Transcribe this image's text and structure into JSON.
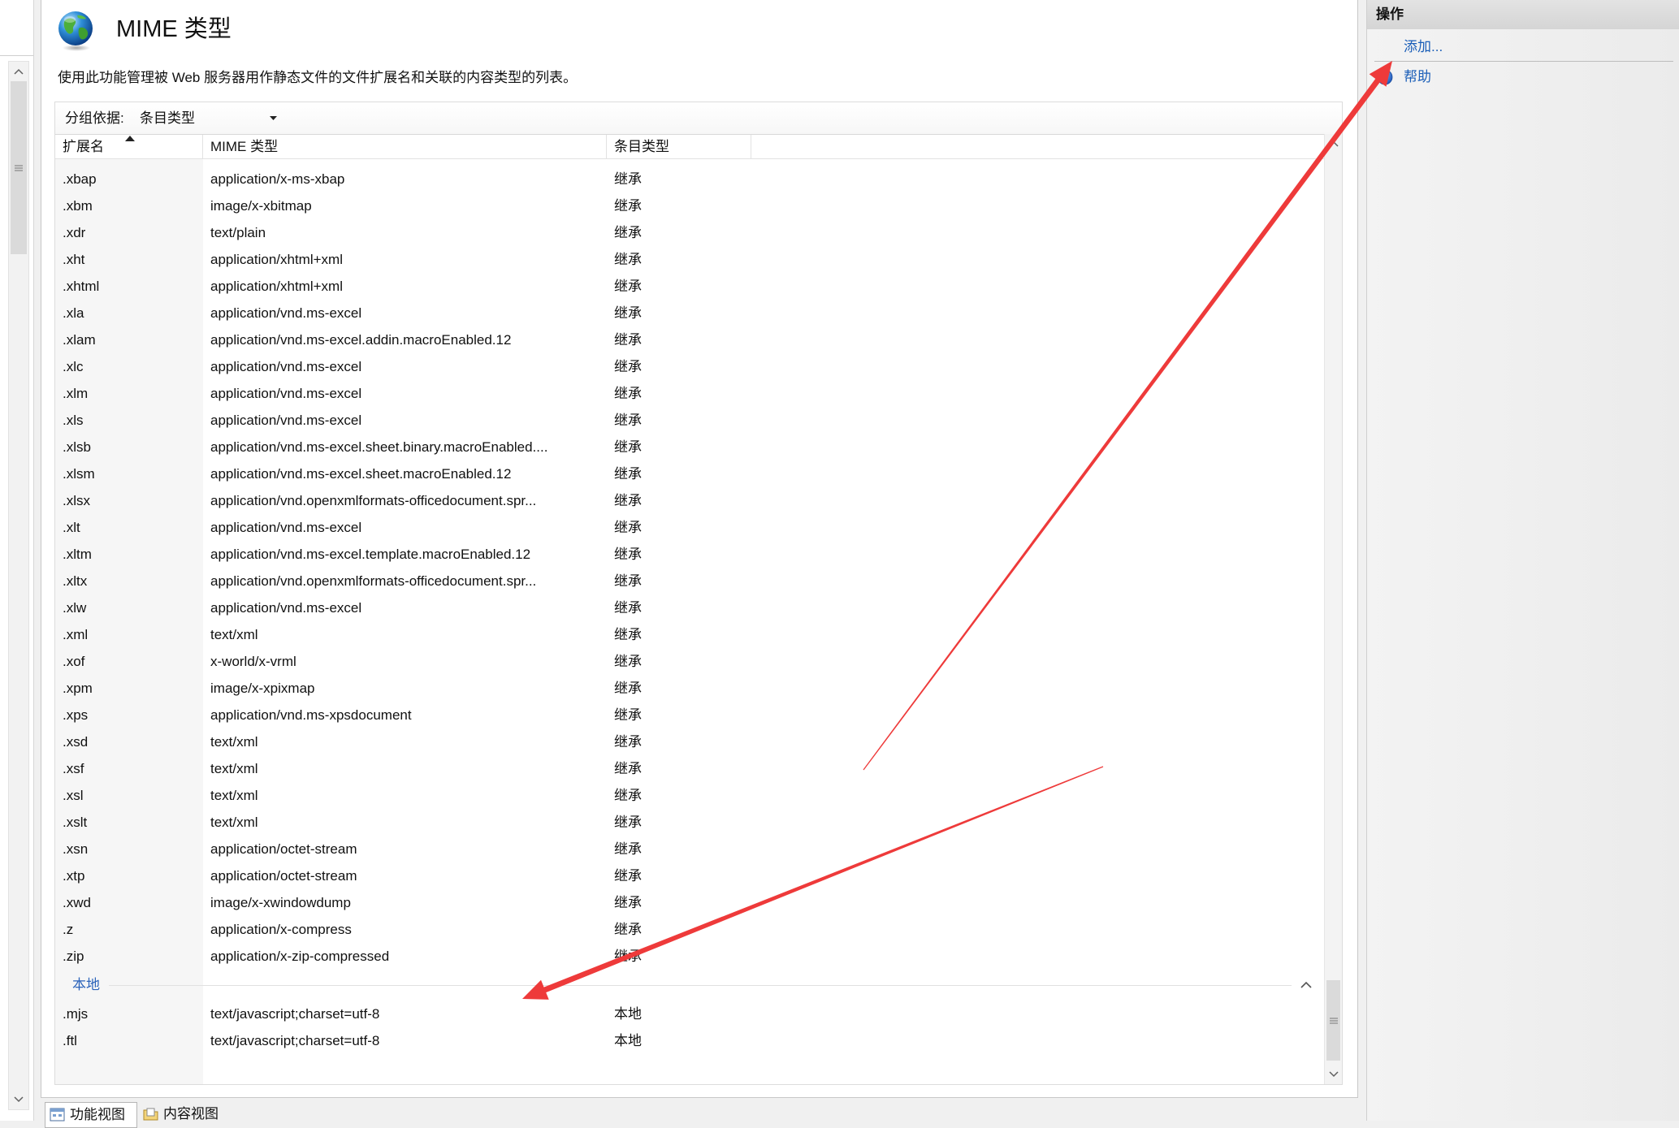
{
  "feature": {
    "icon": "globe-icon",
    "title": "MIME 类型",
    "description": "使用此功能管理被 Web 服务器用作静态文件的文件扩展名和关联的内容类型的列表。"
  },
  "group_by": {
    "label": "分组依据:",
    "value": "条目类型",
    "dropdown_icon": "dropdown-arrow-icon"
  },
  "table": {
    "columns": [
      {
        "label": "扩展名",
        "sort_icon": "sort-ascending-icon"
      },
      {
        "label": "MIME 类型"
      },
      {
        "label": "条目类型"
      }
    ],
    "rows": [
      {
        "ext": ".xbap",
        "mime": "application/x-ms-xbap",
        "type": "继承"
      },
      {
        "ext": ".xbm",
        "mime": "image/x-xbitmap",
        "type": "继承"
      },
      {
        "ext": ".xdr",
        "mime": "text/plain",
        "type": "继承"
      },
      {
        "ext": ".xht",
        "mime": "application/xhtml+xml",
        "type": "继承"
      },
      {
        "ext": ".xhtml",
        "mime": "application/xhtml+xml",
        "type": "继承"
      },
      {
        "ext": ".xla",
        "mime": "application/vnd.ms-excel",
        "type": "继承"
      },
      {
        "ext": ".xlam",
        "mime": "application/vnd.ms-excel.addin.macroEnabled.12",
        "type": "继承"
      },
      {
        "ext": ".xlc",
        "mime": "application/vnd.ms-excel",
        "type": "继承"
      },
      {
        "ext": ".xlm",
        "mime": "application/vnd.ms-excel",
        "type": "继承"
      },
      {
        "ext": ".xls",
        "mime": "application/vnd.ms-excel",
        "type": "继承"
      },
      {
        "ext": ".xlsb",
        "mime": "application/vnd.ms-excel.sheet.binary.macroEnabled....",
        "type": "继承"
      },
      {
        "ext": ".xlsm",
        "mime": "application/vnd.ms-excel.sheet.macroEnabled.12",
        "type": "继承"
      },
      {
        "ext": ".xlsx",
        "mime": "application/vnd.openxmlformats-officedocument.spr...",
        "type": "继承"
      },
      {
        "ext": ".xlt",
        "mime": "application/vnd.ms-excel",
        "type": "继承"
      },
      {
        "ext": ".xltm",
        "mime": "application/vnd.ms-excel.template.macroEnabled.12",
        "type": "继承"
      },
      {
        "ext": ".xltx",
        "mime": "application/vnd.openxmlformats-officedocument.spr...",
        "type": "继承"
      },
      {
        "ext": ".xlw",
        "mime": "application/vnd.ms-excel",
        "type": "继承"
      },
      {
        "ext": ".xml",
        "mime": "text/xml",
        "type": "继承"
      },
      {
        "ext": ".xof",
        "mime": "x-world/x-vrml",
        "type": "继承"
      },
      {
        "ext": ".xpm",
        "mime": "image/x-xpixmap",
        "type": "继承"
      },
      {
        "ext": ".xps",
        "mime": "application/vnd.ms-xpsdocument",
        "type": "继承"
      },
      {
        "ext": ".xsd",
        "mime": "text/xml",
        "type": "继承"
      },
      {
        "ext": ".xsf",
        "mime": "text/xml",
        "type": "继承"
      },
      {
        "ext": ".xsl",
        "mime": "text/xml",
        "type": "继承"
      },
      {
        "ext": ".xslt",
        "mime": "text/xml",
        "type": "继承"
      },
      {
        "ext": ".xsn",
        "mime": "application/octet-stream",
        "type": "继承"
      },
      {
        "ext": ".xtp",
        "mime": "application/octet-stream",
        "type": "继承"
      },
      {
        "ext": ".xwd",
        "mime": "image/x-xwindowdump",
        "type": "继承"
      },
      {
        "ext": ".z",
        "mime": "application/x-compress",
        "type": "继承"
      },
      {
        "ext": ".zip",
        "mime": "application/x-zip-compressed",
        "type": "继承"
      }
    ],
    "local_group": {
      "name": "本地",
      "collapse_icon": "chevron-up-icon",
      "rows": [
        {
          "ext": ".mjs",
          "mime": "text/javascript;charset=utf-8",
          "type": "本地"
        },
        {
          "ext": ".ftl",
          "mime": "text/javascript;charset=utf-8",
          "type": "本地"
        }
      ]
    }
  },
  "view_tabs": [
    {
      "label": "功能视图",
      "icon": "features-view-icon",
      "active": true
    },
    {
      "label": "内容视图",
      "icon": "content-view-icon",
      "active": false
    }
  ],
  "actions": {
    "title": "操作",
    "items": [
      {
        "label": "添加..."
      },
      {
        "label": "帮助",
        "icon": "help-icon"
      }
    ]
  },
  "colors": {
    "link": "#1c5fb8",
    "group_header": "#2b63ba",
    "annotation": "#ee3a3a",
    "sorted_column": "#f6f6f6"
  }
}
